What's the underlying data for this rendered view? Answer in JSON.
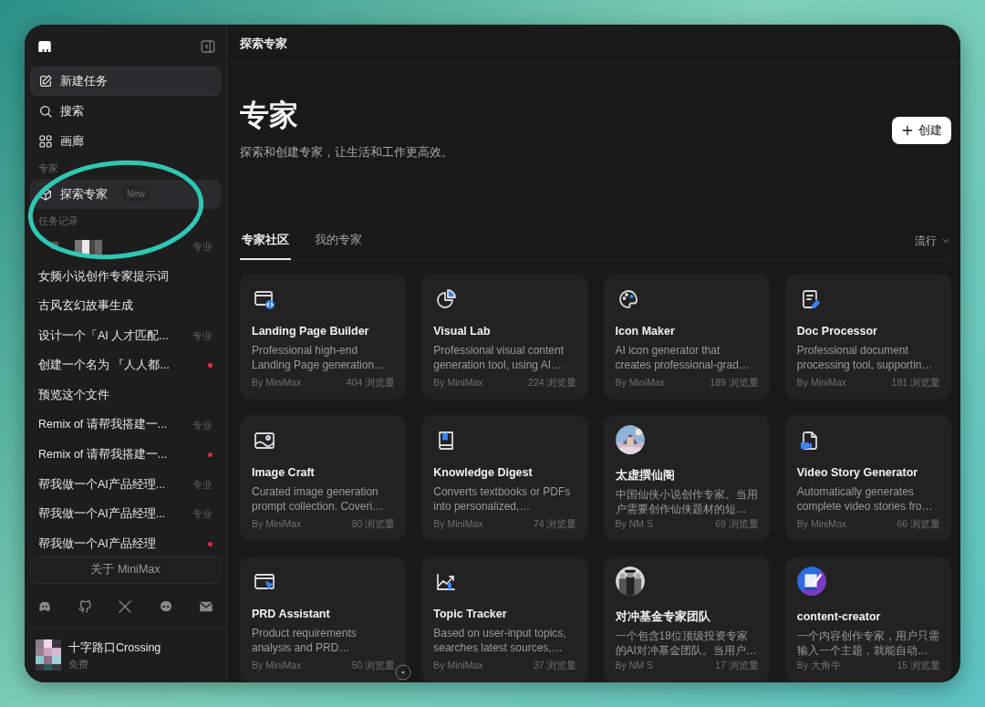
{
  "sidebar": {
    "nav": [
      {
        "kind": "button",
        "label": "新建任务"
      },
      {
        "kind": "link",
        "label": "搜索"
      },
      {
        "kind": "link",
        "label": "画廊"
      }
    ],
    "experts": {
      "label": "专家",
      "items": [
        {
          "label": "探索专家",
          "badge": "New",
          "selected": true
        }
      ]
    },
    "history": {
      "label": "任务记录",
      "items": [
        {
          "kind": "redacted",
          "tag": "专业",
          "unread": false
        },
        {
          "kind": "text",
          "title": "女频小说创作专家提示词",
          "unread": false
        },
        {
          "kind": "text",
          "title": "古风玄幻故事生成",
          "unread": false
        },
        {
          "kind": "text",
          "title": "设计一个「AI 人才匹配...",
          "tag": "专业",
          "unread": false
        },
        {
          "kind": "text",
          "title": "创建一个名为 『人人都...",
          "unread": true
        },
        {
          "kind": "text",
          "title": "预览这个文件",
          "unread": false
        },
        {
          "kind": "text",
          "title": "Remix of 请帮我搭建一...",
          "tag": "专业",
          "unread": false
        },
        {
          "kind": "text",
          "title": "Remix of 请帮我搭建一...",
          "unread": true
        },
        {
          "kind": "text",
          "title": "帮我做一个AI产品经理...",
          "tag": "专业",
          "unread": false
        },
        {
          "kind": "text",
          "title": "帮我做一个AI产品经理...",
          "tag": "专业",
          "unread": false
        },
        {
          "kind": "text",
          "title": "帮我做一个AI产品经理",
          "unread": true
        }
      ]
    },
    "about_button": "关于 MiniMax",
    "user": {
      "name": "十字路口Crossing",
      "plan": "免费"
    }
  },
  "header": {
    "title": "探索专家"
  },
  "hero": {
    "title": "专家",
    "subtitle": "探索和创建专家，让生活和工作更高效。",
    "create_button": "创建"
  },
  "tabs": [
    {
      "label": "专家社区",
      "selected": true
    },
    {
      "label": "我的专家",
      "selected": false
    }
  ],
  "sort": {
    "label": "流行"
  },
  "cards": [
    {
      "kind": "icon",
      "title": "Landing Page Builder",
      "description": "Professional high-end Landing Page generation…",
      "author": "By MiniMax",
      "views": "404 浏览量"
    },
    {
      "kind": "icon",
      "title": "Visual Lab",
      "description": "Professional visual content generation tool, using AI…",
      "author": "By MiniMax",
      "views": "224 浏览量"
    },
    {
      "kind": "icon",
      "title": "Icon Maker",
      "description": "AI icon generator that creates professional-grad…",
      "author": "By MiniMax",
      "views": "189 浏览量"
    },
    {
      "kind": "icon",
      "title": "Doc Processor",
      "description": "Professional document processing tool, supportin…",
      "author": "By MiniMax",
      "views": "181 浏览量"
    },
    {
      "kind": "icon",
      "title": "Image Craft",
      "description": "Curated image generation prompt collection. Coveri…",
      "author": "By MiniMax",
      "views": "80 浏览量"
    },
    {
      "kind": "icon",
      "title": "Knowledge Digest",
      "description": "Converts textbooks or PDFs into personalized,…",
      "author": "By MiniMax",
      "views": "74 浏览量"
    },
    {
      "kind": "picture",
      "title": "太虚撰仙阁",
      "description": "中国仙侠小说创作专家。当用户需要创作仙侠题材的短…",
      "author": "By NM S",
      "views": "69 浏览量"
    },
    {
      "kind": "icon",
      "title": "Video Story Generator",
      "description": "Automatically generates complete video stories fro…",
      "author": "By MiniMax",
      "views": "66 浏览量"
    },
    {
      "kind": "icon",
      "title": "PRD Assistant",
      "description": "Product requirements analysis and PRD…",
      "author": "By MiniMax",
      "views": "50 浏览量"
    },
    {
      "kind": "icon",
      "title": "Topic Tracker",
      "description": "Based on user-input topics, searches latest sources,…",
      "author": "By MiniMax",
      "views": "37 浏览量"
    },
    {
      "kind": "picture",
      "title": "对冲基金专家团队",
      "description": "一个包含18位顶级投资专家的AI对冲基金团队。当用户…",
      "author": "By NM S",
      "views": "17 浏览量"
    },
    {
      "kind": "picture",
      "title": "content-creator",
      "description": "一个内容创作专家，用户只需输入一个主题，就能自动…",
      "author": "By 大角牛",
      "views": "15 浏览量"
    }
  ]
}
